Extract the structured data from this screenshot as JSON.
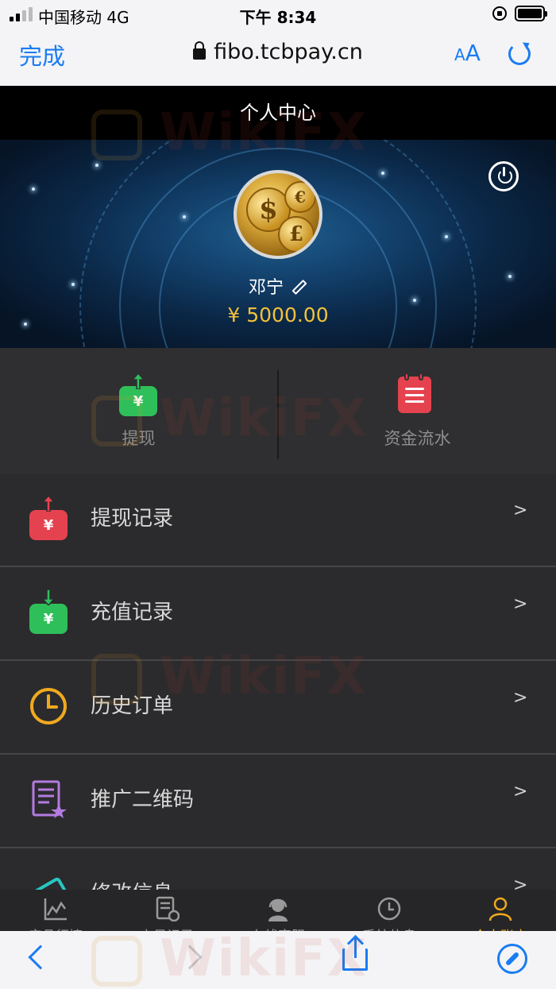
{
  "status_bar": {
    "carrier": "中国移动  4G",
    "time": "下午 8:34"
  },
  "browser": {
    "done_label": "完成",
    "url": "fibo.tcbpay.cn",
    "text_size_small": "A",
    "text_size_large": "A",
    "accent_color": "#1a7cf2"
  },
  "page": {
    "title": "个人中心"
  },
  "profile": {
    "username": "邓宁",
    "balance": "¥ 5000.00",
    "balance_color": "#f2c23a"
  },
  "actions": [
    {
      "label": "提现",
      "icon": "withdraw-tray-icon",
      "color": "#2fbf5a"
    },
    {
      "label": "资金流水",
      "icon": "clipboard-list-icon",
      "color": "#e5424f"
    }
  ],
  "menu": [
    {
      "label": "提现记录",
      "icon": "withdraw-record-icon",
      "color": "#e5424f",
      "chevron": ">"
    },
    {
      "label": "充值记录",
      "icon": "deposit-record-icon",
      "color": "#2fbf5a",
      "chevron": ">"
    },
    {
      "label": "历史订单",
      "icon": "clock-icon",
      "color": "#f0a91f",
      "chevron": ">"
    },
    {
      "label": "推广二维码",
      "icon": "certificate-icon",
      "color": "#b37be0",
      "chevron": ">"
    },
    {
      "label": "修改信息",
      "icon": "edit-card-icon",
      "color": "#27c7c2",
      "chevron": ">"
    }
  ],
  "tabbar": [
    {
      "label": "产品行情",
      "icon": "chart-icon"
    },
    {
      "label": "交易记录",
      "icon": "record-icon"
    },
    {
      "label": "在线客服",
      "icon": "support-icon"
    },
    {
      "label": "系统信息",
      "icon": "clock-icon"
    },
    {
      "label": "个人账户",
      "icon": "user-icon",
      "active": true,
      "active_color": "#f0a91f"
    }
  ],
  "watermark": "WikiFX"
}
